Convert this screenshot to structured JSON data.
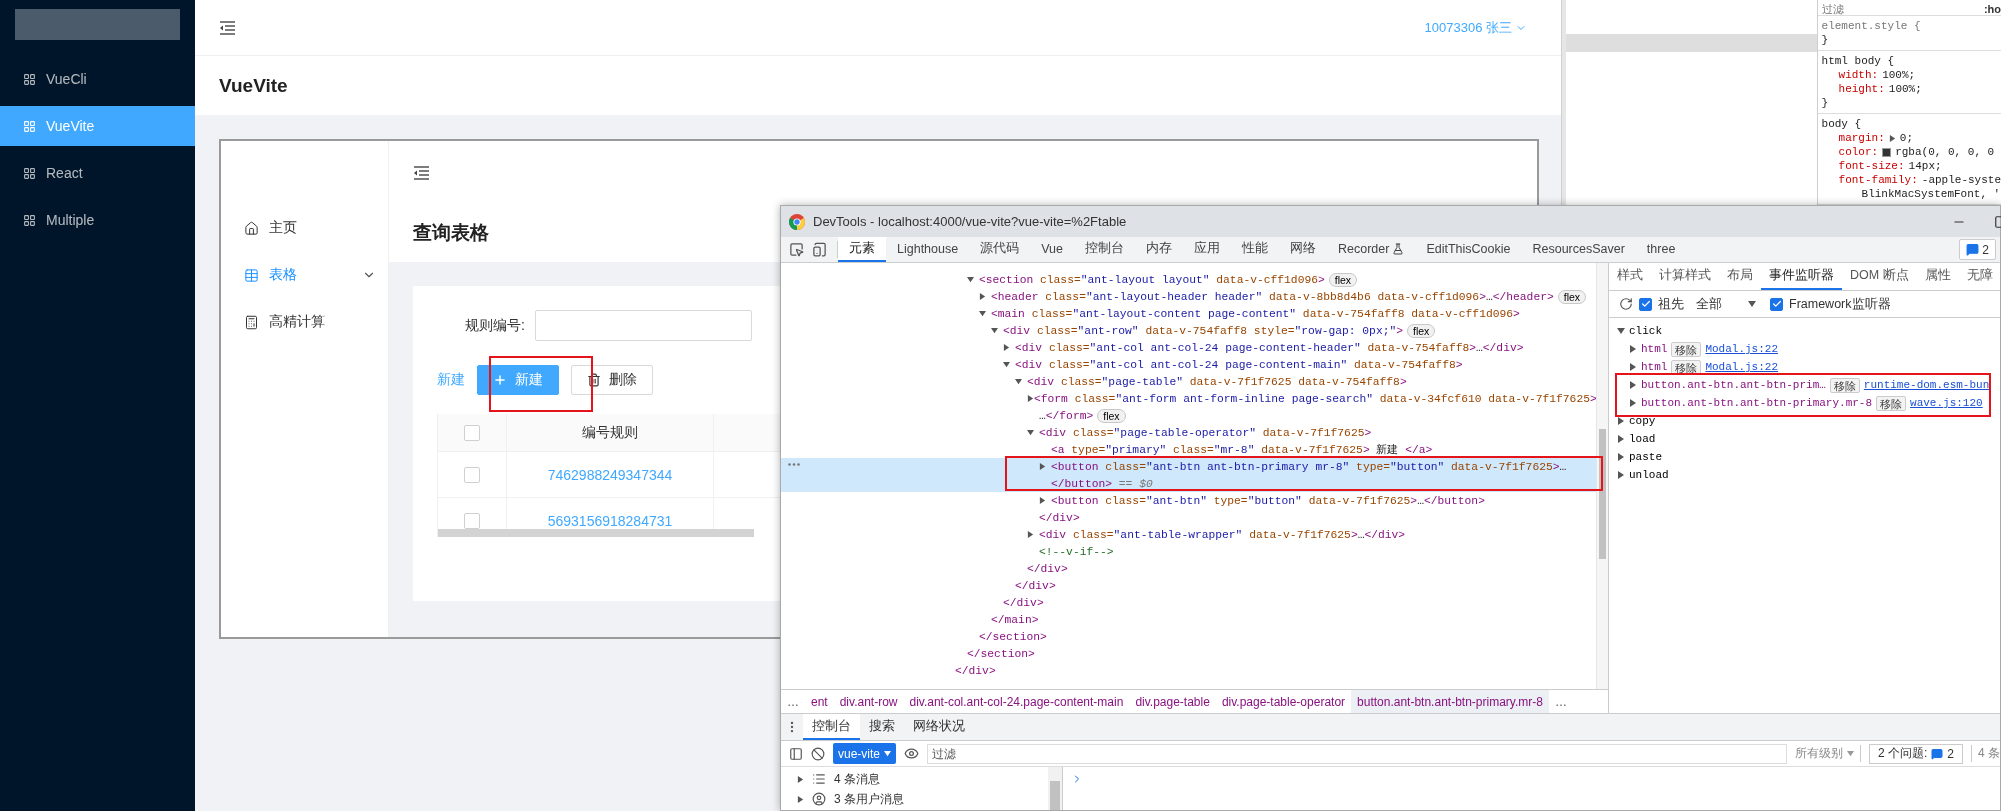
{
  "app": {
    "nav": [
      {
        "label": "VueCli",
        "selected": false
      },
      {
        "label": "VueVite",
        "selected": true
      },
      {
        "label": "React",
        "selected": false
      },
      {
        "label": "Multiple",
        "selected": false
      }
    ],
    "user": "10073306 张三",
    "page_title": "VueVite",
    "frame": {
      "menu": [
        {
          "kind": "home",
          "label": "主页",
          "selected": false
        },
        {
          "kind": "table",
          "label": "表格",
          "selected": true,
          "expanded": false
        },
        {
          "kind": "calculator",
          "label": "高精计算",
          "selected": false
        }
      ],
      "heading": "查询表格",
      "search": {
        "label": "规则编号:"
      },
      "operators": [
        {
          "kind": "link",
          "label": "新建"
        },
        {
          "kind": "primary",
          "label": "新建"
        },
        {
          "kind": "default",
          "label": "删除"
        }
      ],
      "table": {
        "header_checked": false,
        "columns": [
          "编号规则"
        ],
        "rows": [
          {
            "checked": false,
            "cells": [
              "7462988249347344"
            ]
          },
          {
            "checked": false,
            "cells": [
              "5693156918284731"
            ]
          }
        ]
      }
    }
  },
  "styles_window": {
    "filter": {
      "placeholder": "过滤"
    },
    "pseudo": ":ho",
    "rules": [
      {
        "selector": "element.style {",
        "close": "}"
      },
      {
        "selector": "html body {",
        "declarations": [
          {
            "kind": "plain",
            "property": "width:",
            "value": "100%;"
          },
          {
            "kind": "plain",
            "property": "height:",
            "value": "100%;"
          }
        ],
        "close": "}"
      },
      {
        "selector": "body {",
        "declarations": [
          {
            "kind": "shorthand",
            "property": "margin:",
            "value": "0;"
          },
          {
            "kind": "color",
            "property": "color:",
            "value": "rgba(0, 0, 0, 0"
          },
          {
            "kind": "plain",
            "property": "font-size:",
            "value": "14px;"
          },
          {
            "kind": "plain",
            "property": "font-family:",
            "value": "-apple-syste"
          }
        ],
        "continuation": "BlinkMacSystemFont, '"
      }
    ]
  },
  "devtools": {
    "title": "DevTools - localhost:4000/vue-vite?vue-vite=%2Ftable",
    "tabs": [
      {
        "kind": "plain",
        "label": "元素",
        "selected": true
      },
      {
        "kind": "plain",
        "label": "Lighthouse",
        "selected": false
      },
      {
        "kind": "plain",
        "label": "源代码",
        "selected": false
      },
      {
        "kind": "plain",
        "label": "Vue",
        "selected": false
      },
      {
        "kind": "plain",
        "label": "控制台",
        "selected": false
      },
      {
        "kind": "plain",
        "label": "内存",
        "selected": false
      },
      {
        "kind": "plain",
        "label": "应用",
        "selected": false
      },
      {
        "kind": "plain",
        "label": "性能",
        "selected": false
      },
      {
        "kind": "plain",
        "label": "网络",
        "selected": false
      },
      {
        "kind": "experiment",
        "label": "Recorder",
        "selected": false
      },
      {
        "kind": "plain",
        "label": "EditThisCookie",
        "selected": false
      },
      {
        "kind": "plain",
        "label": "ResourcesSaver",
        "selected": false
      },
      {
        "kind": "plain",
        "label": "three",
        "selected": false
      }
    ],
    "issues_badge": "2",
    "dom_tree": [
      {
        "close": "</div>",
        "children": [
          {
            "close": "</section>",
            "children": [
              {
                "kind": "element",
                "expanded": true,
                "selected": false,
                "lines": [
                  "<section class=\"ant-layout layout\" data-v-cff1d096>"
                ],
                "badge": "flex",
                "close": "</section>",
                "children": [
                  {
                    "kind": "element",
                    "expanded": false,
                    "selected": false,
                    "lines": [
                      "<header class=\"ant-layout-header header\" data-v-8bb8d4b6 data-v-cff1d096>…</header>"
                    ],
                    "badge": "flex"
                  },
                  {
                    "kind": "element",
                    "expanded": true,
                    "selected": false,
                    "lines": [
                      "<main class=\"ant-layout-content page-content\" data-v-754faff8 data-v-cff1d096>"
                    ],
                    "close": "</main>",
                    "children": [
                      {
                        "kind": "element",
                        "expanded": true,
                        "selected": false,
                        "lines": [
                          "<div class=\"ant-row\" data-v-754faff8 style=\"row-gap: 0px;\">"
                        ],
                        "badge": "flex",
                        "close": "</div>",
                        "children": [
                          {
                            "kind": "element",
                            "expanded": false,
                            "selected": false,
                            "lines": [
                              "<div class=\"ant-col ant-col-24 page-content-header\" data-v-754faff8>…</div>"
                            ]
                          },
                          {
                            "kind": "element",
                            "expanded": true,
                            "selected": false,
                            "lines": [
                              "<div class=\"ant-col ant-col-24 page-content-main\" data-v-754faff8>"
                            ],
                            "close": "</div>",
                            "children": [
                              {
                                "kind": "element",
                                "expanded": true,
                                "selected": false,
                                "lines": [
                                  "<div class=\"page-table\" data-v-7f1f7625 data-v-754faff8>"
                                ],
                                "close": "</div>",
                                "children": [
                                  {
                                    "kind": "element",
                                    "expanded": false,
                                    "selected": false,
                                    "lines": [
                                      "<form class=\"ant-form ant-form-inline page-search\" data-v-34fcf610 data-v-7f1f7625>",
                                      "…</form>"
                                    ],
                                    "badge": "flex"
                                  },
                                  {
                                    "kind": "element",
                                    "expanded": true,
                                    "selected": false,
                                    "lines": [
                                      "<div class=\"page-table-operator\" data-v-7f1f7625>"
                                    ],
                                    "close": "</div>",
                                    "children": [
                                      {
                                        "kind": "element",
                                        "selected": false,
                                        "lines": [
                                          "<a type=\"primary\" class=\"mr-8\" data-v-7f1f7625> 新建 </a>"
                                        ]
                                      },
                                      {
                                        "kind": "element",
                                        "expanded": false,
                                        "selected": true,
                                        "lines": [
                                          "<button class=\"ant-btn ant-btn-primary mr-8\" type=\"button\" data-v-7f1f7625>…",
                                          "</button> == $0"
                                        ]
                                      },
                                      {
                                        "kind": "element",
                                        "expanded": false,
                                        "selected": false,
                                        "lines": [
                                          "<button class=\"ant-btn\" type=\"button\" data-v-7f1f7625>…</button>"
                                        ]
                                      }
                                    ]
                                  },
                                  {
                                    "kind": "element",
                                    "expanded": false,
                                    "selected": false,
                                    "lines": [
                                      "<div class=\"ant-table-wrapper\" data-v-7f1f7625>…</div>"
                                    ]
                                  },
                                  {
                                    "kind": "comment",
                                    "selected": false,
                                    "lines": [
                                      "<!--v-if-->"
                                    ]
                                  }
                                ]
                              }
                            ]
                          }
                        ]
                      }
                    ]
                  }
                ]
              }
            ]
          }
        ]
      }
    ],
    "breadcrumbs": {
      "left": "…",
      "right": "…",
      "items": [
        {
          "label": "ent",
          "selected": false
        },
        {
          "label": "div.ant-row",
          "selected": false
        },
        {
          "label": "div.ant-col.ant-col-24.page-content-main",
          "selected": false
        },
        {
          "label": "div.page-table",
          "selected": false
        },
        {
          "label": "div.page-table-operator",
          "selected": false
        },
        {
          "label": "button.ant-btn.ant-btn-primary.mr-8",
          "selected": true
        }
      ]
    },
    "side_tabs": [
      {
        "label": "样式",
        "selected": false
      },
      {
        "label": "计算样式",
        "selected": false
      },
      {
        "label": "布局",
        "selected": false
      },
      {
        "label": "事件监听器",
        "selected": true
      },
      {
        "label": "DOM 断点",
        "selected": false
      },
      {
        "label": "属性",
        "selected": false
      },
      {
        "label": "无障",
        "selected": false
      }
    ],
    "listener_toolbar": {
      "ancestors": {
        "label": "祖先",
        "checked": true
      },
      "scope": "全部",
      "framework": {
        "label": "Framework监听器",
        "checked": true
      }
    },
    "listeners": [
      {
        "event": "click",
        "expanded": true,
        "handlers": [
          {
            "target": "html",
            "action": "移除",
            "source": "Modal.js:22",
            "expanded": false
          },
          {
            "target": "html",
            "action": "移除",
            "source": "Modal.js:22",
            "expanded": false
          },
          {
            "target": "button.ant-btn.ant-btn-prim…",
            "action": "移除",
            "source": "runtime-dom.esm-bun",
            "expanded": false
          },
          {
            "target": "button.ant-btn.ant-btn-primary.mr-8",
            "action": "移除",
            "source": "wave.js:120",
            "expanded": false
          }
        ]
      },
      {
        "event": "copy",
        "expanded": false
      },
      {
        "event": "load",
        "expanded": false
      },
      {
        "event": "paste",
        "expanded": false
      },
      {
        "event": "unload",
        "expanded": false
      }
    ],
    "drawer": {
      "tabs": [
        {
          "label": "控制台",
          "selected": true
        },
        {
          "label": "搜索",
          "selected": false
        },
        {
          "label": "网络状况",
          "selected": false
        }
      ],
      "context": "vue-vite",
      "filter": {
        "placeholder": "过滤"
      },
      "levels": "所有级别",
      "issues": {
        "label": "2 个问题:",
        "count": "2"
      },
      "messages_count": "4 条",
      "sidebar": [
        {
          "kind": "list",
          "label": "4 条消息",
          "expanded": false
        },
        {
          "kind": "user",
          "label": "3 条用户消息",
          "expanded": false
        }
      ]
    }
  }
}
